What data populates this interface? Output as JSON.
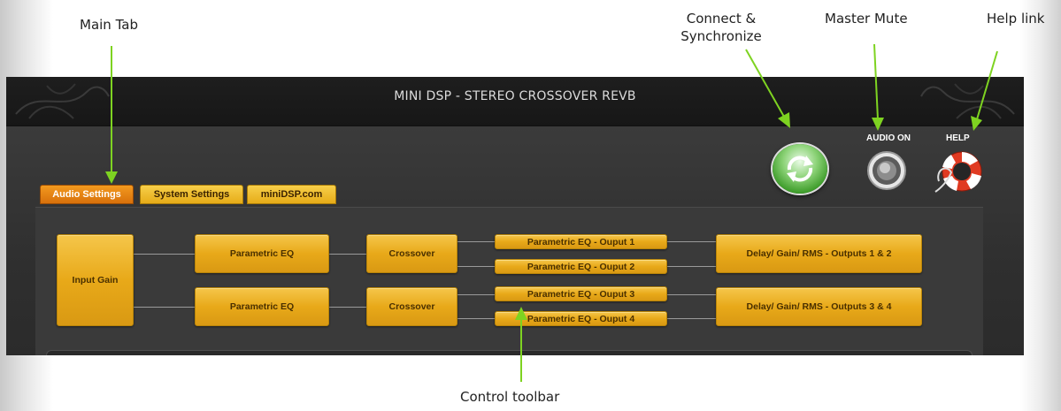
{
  "callouts": {
    "main_tab": "Main Tab",
    "connect_line1": "Connect &",
    "connect_line2": "Synchronize",
    "master_mute": "Master Mute",
    "help_link": "Help link",
    "control_toolbar": "Control toolbar"
  },
  "app": {
    "title": "MINI DSP - STEREO CROSSOVER REVB",
    "audio_label": "AUDIO ON",
    "help_label": "HELP",
    "tabs": [
      {
        "label": "Audio Settings",
        "active": true
      },
      {
        "label": "System Settings",
        "active": false
      },
      {
        "label": "miniDSP.com",
        "active": false
      }
    ]
  },
  "toolbar": {
    "input_gain": "Input Gain",
    "peq_1": "Parametric EQ",
    "peq_2": "Parametric EQ",
    "crossover_1": "Crossover",
    "crossover_2": "Crossover",
    "out_peq_1": "Parametric EQ - Ouput 1",
    "out_peq_2": "Parametric EQ - Ouput 2",
    "out_peq_3": "Parametric EQ - Ouput 3",
    "out_peq_4": "Parametric EQ - Ouput 4",
    "dgr_12": "Delay/ Gain/ RMS - Outputs 1 & 2",
    "dgr_34": "Delay/ Gain/ RMS - Outputs 3 & 4"
  },
  "colors": {
    "arrow": "#7ed321",
    "tab_active": "#e07d10",
    "tab_inactive": "#f0be34",
    "block": "#e8a919",
    "background": "#262626"
  },
  "icons": [
    "sync-icon",
    "speaker-icon",
    "lifebuoy-icon"
  ]
}
